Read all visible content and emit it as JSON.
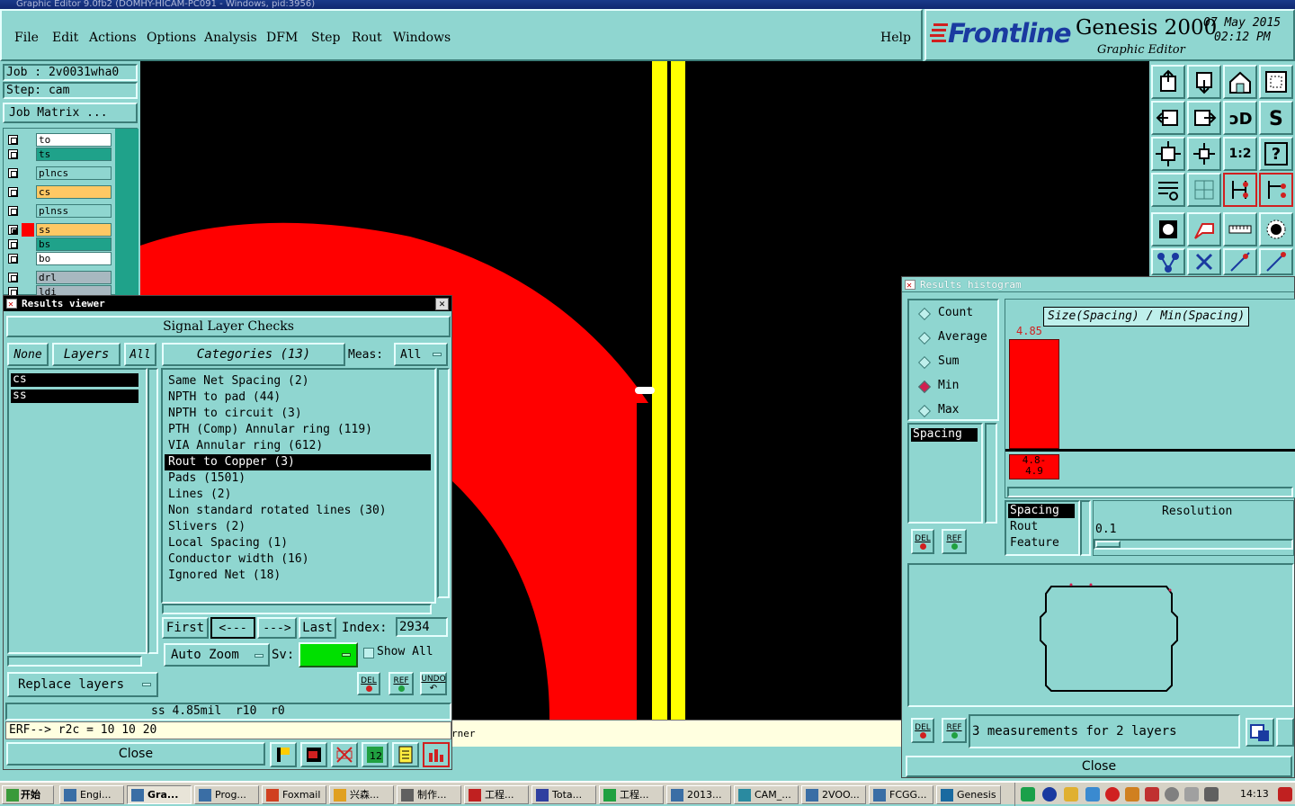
{
  "window_title": "Graphic Editor 9.0fb2 (DOMHY-HICAM-PC091 - Windows, pid:3956)",
  "menu": [
    "File",
    "Edit",
    "Actions",
    "Options",
    "Analysis",
    "DFM",
    "Step",
    "Rout",
    "Windows"
  ],
  "help": "Help",
  "brand": {
    "logo": "Frontline",
    "product": "Genesis 2000",
    "subtitle": "Graphic Editor",
    "date": "07 May 2015",
    "time": "02:12 PM"
  },
  "job": {
    "job_label": "Job : 2v0031wha0",
    "step_label": "Step: cam",
    "matrix_button": "Job Matrix ..."
  },
  "layers": [
    {
      "name": "to",
      "color": "#ffffff"
    },
    {
      "name": "ts",
      "color": "#1fa28a"
    },
    {
      "name": "plncs",
      "color": "#8fd6d0"
    },
    {
      "name": "cs",
      "color": "#ffc864"
    },
    {
      "name": "plnss",
      "color": "#8fd6d0"
    },
    {
      "name": "ss",
      "color": "#ffc864"
    },
    {
      "name": "bs",
      "color": "#1fa28a"
    },
    {
      "name": "bo",
      "color": "#ffffff"
    },
    {
      "name": "drl",
      "color": "#a8b8c0"
    },
    {
      "name": "ldi",
      "color": "#a8b8c0"
    }
  ],
  "results_viewer": {
    "title": "Results viewer",
    "heading": "Signal Layer Checks",
    "none_btn": "None",
    "layers_btn": "Layers",
    "all_btn": "All",
    "categories_btn": "Categories (13)",
    "meas_label": "Meas:",
    "meas_value": "All",
    "layer_list": [
      "cs",
      "ss"
    ],
    "categories": [
      "Same Net Spacing (2)",
      "NPTH to pad (44)",
      "NPTH to circuit (3)",
      "PTH (Comp) Annular ring (119)",
      "VIA Annular ring (612)",
      "Rout to Copper (3)",
      "Pads (1501)",
      "Lines (2)",
      "Non standard rotated lines (30)",
      "Slivers (2)",
      "Local Spacing (1)",
      "Conductor width (16)",
      "Ignored Net (18)"
    ],
    "selected_category": 5,
    "first_btn": "First",
    "prev_btn": "<---",
    "next_btn": "--->",
    "last_btn": "Last",
    "index_label": "Index:",
    "index_value": "2934",
    "auto_zoom": "Auto Zoom",
    "sv_label": "Sv:",
    "show_all": "Show All",
    "del_label": "DEL",
    "ref_label": "REF",
    "undo_label": "UNDO",
    "replace_layers": "Replace layers",
    "status_line": "ss 4.85mil  r10  r0",
    "erf_line": "ERF--> r2c = 10 10 20",
    "close_btn": "Close"
  },
  "canvas_status_fragment": "rner",
  "histogram": {
    "title": "Results histogram",
    "options": [
      "Count",
      "Average",
      "Sum",
      "Min",
      "Max"
    ],
    "selected_option": "Min",
    "y_label": "Size(Spacing) / Min(Spacing)",
    "bar_value": "4.85",
    "bin_label": "4.8-\n4.9",
    "bar_fraction": 1.0,
    "list_items": [
      "Spacing"
    ],
    "field_list": [
      "Spacing",
      "Rout",
      "Feature"
    ],
    "resolution_label": "Resolution",
    "resolution_value": "0.1",
    "del_label": "DEL",
    "ref_label": "REF",
    "measurement_text": "3 measurements for 2 layers",
    "close_btn": "Close"
  },
  "toolbar_icons": [
    "home-icon",
    "zoom-fit-icon",
    "one-to-one-icon",
    "help-icon"
  ],
  "toolbar_texts": [
    "1:2",
    "?"
  ],
  "taskbar": {
    "start": "开始",
    "tasks": [
      "Engi...",
      "Gra...",
      "Prog...",
      "Foxmail",
      "兴森...",
      "制作...",
      "工程...",
      "Tota...",
      "工程...",
      "2013...",
      "CAM_...",
      "2VOO...",
      "FCGG...",
      "Genesis"
    ],
    "clock": "14:13"
  }
}
